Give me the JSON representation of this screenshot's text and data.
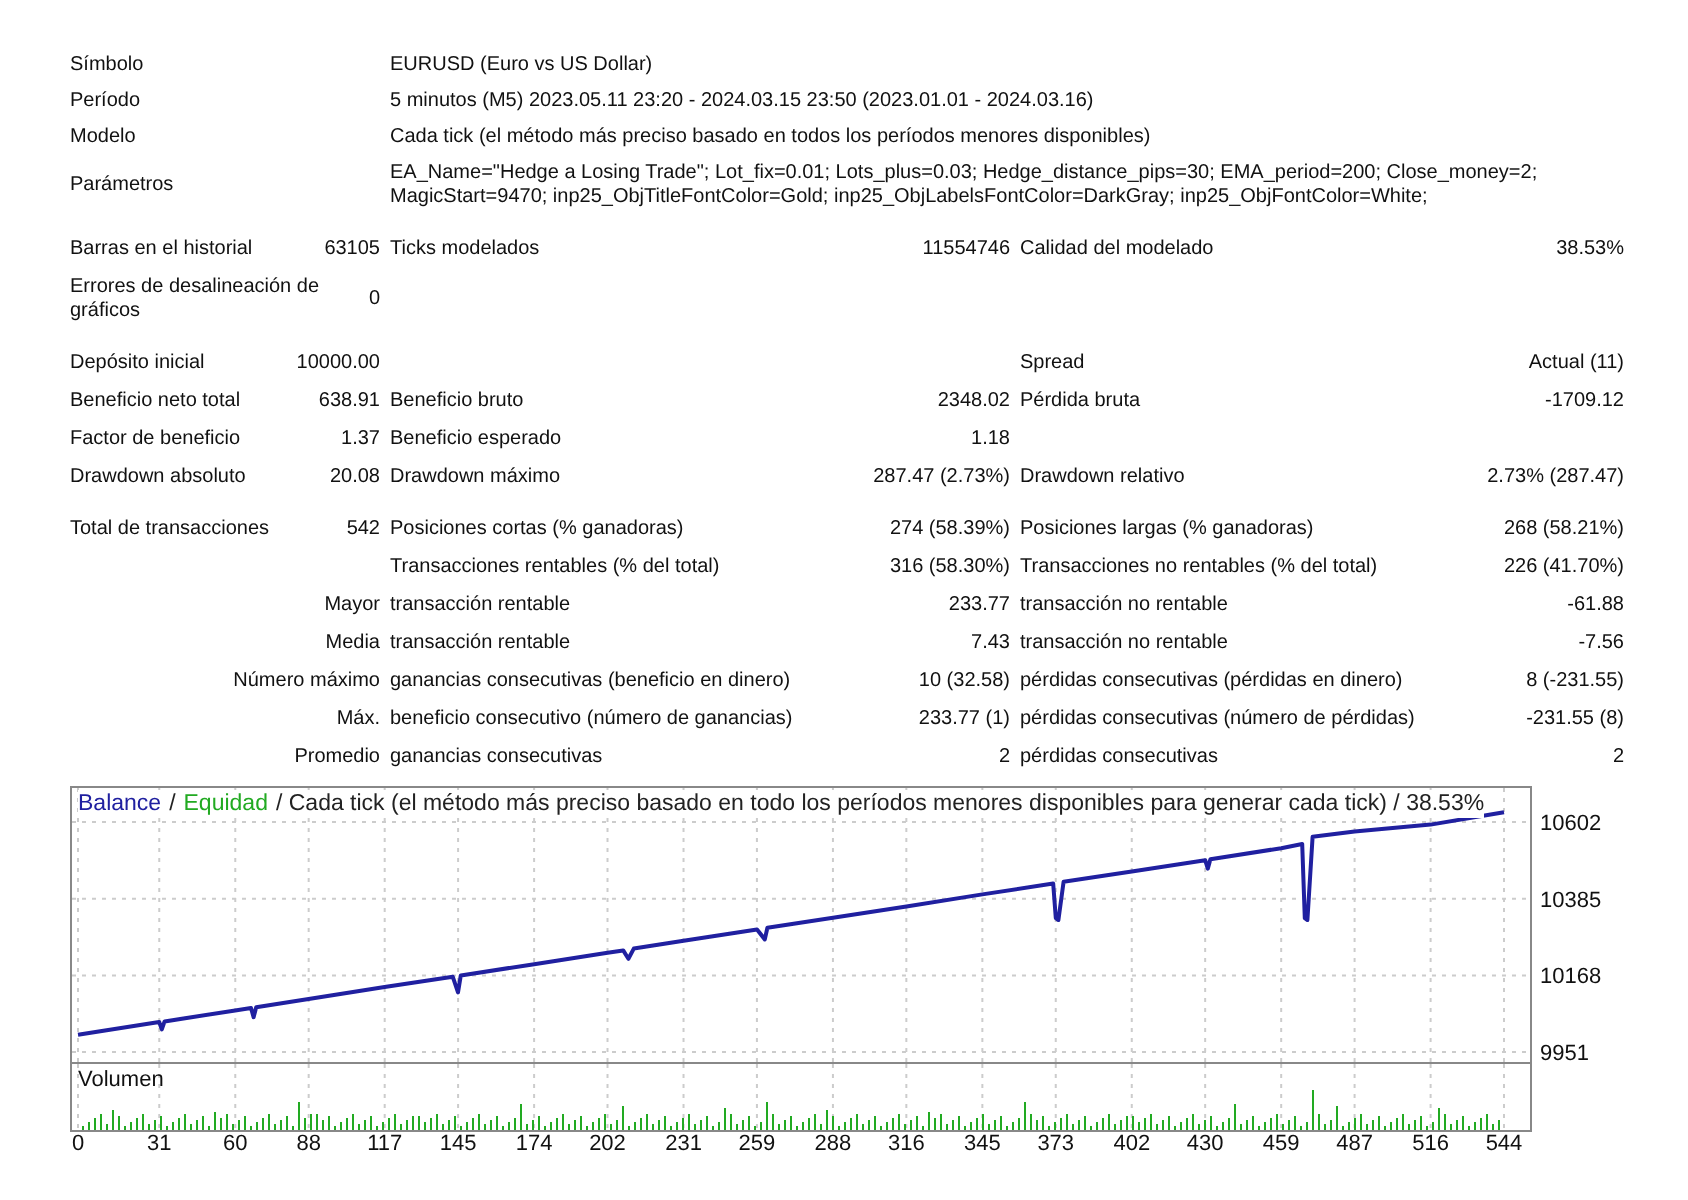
{
  "info": [
    {
      "label": "Símbolo",
      "value": "EURUSD (Euro vs US Dollar)"
    },
    {
      "label": "Período",
      "value": "5 minutos (M5) 2023.05.11 23:20 - 2024.03.15 23:50 (2023.01.01 - 2024.03.16)"
    },
    {
      "label": "Modelo",
      "value": "Cada tick (el método más preciso basado en todos los períodos menores disponibles)"
    },
    {
      "label": "Parámetros",
      "value": "EA_Name=\"Hedge a Losing Trade\"; Lot_fix=0.01; Lots_plus=0.03; Hedge_distance_pips=30; EMA_period=200; Close_money=2; MagicStart=9470; inp25_ObjTitleFontColor=Gold; inp25_ObjLabelsFontColor=DarkGray; inp25_ObjFontColor=White;"
    }
  ],
  "sections": [
    {
      "rows": [
        {
          "kind": "main",
          "left": {
            "label": "Barras en el historial",
            "value": "63105"
          },
          "middle": {
            "label": "Ticks modelados",
            "value": "11554746"
          },
          "right": {
            "label": "Calidad del modelado",
            "value": "38.53%"
          }
        },
        {
          "kind": "main",
          "left": {
            "label": "Errores de desalineación de gráficos",
            "value": "0"
          }
        }
      ]
    },
    {
      "rows": [
        {
          "kind": "main",
          "left": {
            "label": "Depósito inicial",
            "value": "10000.00"
          },
          "right": {
            "label": "Spread",
            "value": "Actual (11)"
          }
        },
        {
          "kind": "main",
          "left": {
            "label": "Beneficio neto total",
            "value": "638.91"
          },
          "middle": {
            "label": "Beneficio bruto",
            "value": "2348.02"
          },
          "right": {
            "label": "Pérdida bruta",
            "value": "-1709.12"
          }
        },
        {
          "kind": "main",
          "left": {
            "label": "Factor de beneficio",
            "value": "1.37"
          },
          "middle": {
            "label": "Beneficio esperado",
            "value": "1.18"
          }
        },
        {
          "kind": "main",
          "left": {
            "label": "Drawdown absoluto",
            "value": "20.08"
          },
          "middle": {
            "label": "Drawdown máximo",
            "value": "287.47 (2.73%)"
          },
          "right": {
            "label": "Drawdown relativo",
            "value": "2.73% (287.47)"
          }
        }
      ]
    },
    {
      "rows": [
        {
          "kind": "main",
          "left": {
            "label": "Total de transacciones",
            "value": "542"
          },
          "middle": {
            "label": "Posiciones cortas (% ganadoras)",
            "value": "274 (58.39%)"
          },
          "right": {
            "label": "Posiciones largas (% ganadoras)",
            "value": "268 (58.21%)"
          }
        },
        {
          "kind": "main",
          "middle": {
            "label": "Transacciones rentables (% del total)",
            "value": "316 (58.30%)"
          },
          "right": {
            "label": "Transacciones no rentables (% del total)",
            "value": "226 (41.70%)"
          }
        },
        {
          "kind": "sub",
          "left": {
            "label": "Mayor"
          },
          "middle": {
            "label": "transacción rentable",
            "value": "233.77"
          },
          "right": {
            "label": "transacción no rentable",
            "value": "-61.88"
          }
        },
        {
          "kind": "sub",
          "left": {
            "label": "Media"
          },
          "middle": {
            "label": "transacción rentable",
            "value": "7.43"
          },
          "right": {
            "label": "transacción no rentable",
            "value": "-7.56"
          }
        },
        {
          "kind": "sub",
          "left": {
            "label": "Número máximo"
          },
          "middle": {
            "label": "ganancias consecutivas (beneficio en dinero)",
            "value": "10 (32.58)"
          },
          "right": {
            "label": "pérdidas consecutivas (pérdidas en dinero)",
            "value": "8 (-231.55)"
          }
        },
        {
          "kind": "sub",
          "left": {
            "label": "Máx."
          },
          "middle": {
            "label": "beneficio consecutivo (número de ganancias)",
            "value": "233.77 (1)"
          },
          "right": {
            "label": "pérdidas consecutivas (número de pérdidas)",
            "value": "-231.55 (8)"
          }
        },
        {
          "kind": "sub",
          "left": {
            "label": "Promedio"
          },
          "middle": {
            "label": "ganancias consecutivas",
            "value": "2"
          },
          "right": {
            "label": "pérdidas consecutivas",
            "value": "2"
          }
        }
      ]
    }
  ],
  "graph": {
    "header": [
      {
        "kind": "text",
        "text": "/"
      },
      {
        "kind": "series",
        "text": "Equidad",
        "color": "#22aa22"
      },
      {
        "kind": "text",
        "text": "/ Cada tick (el método más preciso basado en todo los períodos menores disponibles para generar cada tick)  / 38.53%"
      }
    ],
    "volume_label": "Volumen",
    "chart_data": {
      "type": "line",
      "x": [
        0,
        31,
        32,
        33,
        60,
        66,
        67,
        68,
        88,
        117,
        143,
        145,
        146,
        174,
        202,
        208,
        210,
        212,
        231,
        259,
        262,
        263,
        288,
        316,
        345,
        372,
        373,
        374,
        376,
        402,
        430,
        431,
        432,
        459,
        467,
        468,
        469,
        471,
        487,
        516,
        540,
        544
      ],
      "series": [
        {
          "name": "Balance",
          "color": "#2020a0",
          "values": [
            10000,
            10036,
            10015,
            10038,
            10069,
            10076,
            10050,
            10078,
            10101,
            10135,
            10164,
            10120,
            10168,
            10200,
            10232,
            10239,
            10215,
            10244,
            10266,
            10298,
            10270,
            10303,
            10331,
            10363,
            10397,
            10428,
            10330,
            10325,
            10433,
            10462,
            10494,
            10470,
            10497,
            10528,
            10540,
            10330,
            10325,
            10560,
            10575,
            10595,
            10625,
            10630
          ]
        }
      ],
      "grid": true,
      "xlim": [
        0,
        544
      ],
      "ylim": [
        9923,
        10704
      ],
      "xticks": [
        0,
        31,
        60,
        88,
        117,
        145,
        174,
        202,
        231,
        259,
        288,
        316,
        345,
        373,
        402,
        430,
        459,
        487,
        516,
        544
      ],
      "yticks": [
        9951,
        10168,
        10385,
        10602
      ]
    }
  }
}
